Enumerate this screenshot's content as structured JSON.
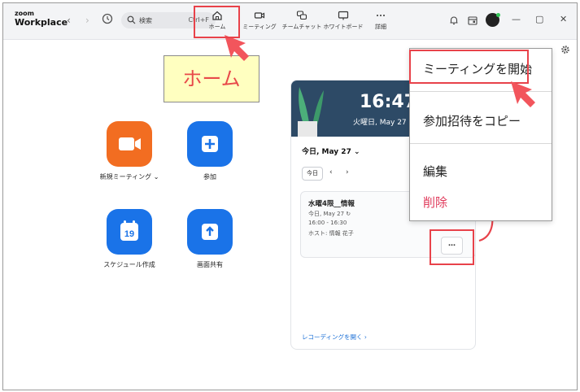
{
  "brand": {
    "line1": "zoom",
    "line2": "Workplace"
  },
  "search": {
    "placeholder": "検索",
    "shortcut": "Ctrl+F"
  },
  "nav": [
    {
      "label": "ホーム",
      "icon": "home-icon"
    },
    {
      "label": "ミーティング",
      "icon": "video-icon"
    },
    {
      "label": "チームチャット",
      "icon": "chat-icon"
    },
    {
      "label": "ホワイトボード",
      "icon": "whiteboard-icon"
    },
    {
      "label": "詳細",
      "icon": "more-icon"
    }
  ],
  "annotation": {
    "home_label": "ホーム"
  },
  "actions": [
    {
      "label": "新規ミーティング",
      "suffix": "⌄",
      "icon": "video-camera-icon",
      "color": "#f26d21"
    },
    {
      "label": "参加",
      "icon": "plus-icon",
      "color": "#1a73e8"
    },
    {
      "label": "スケジュール作成",
      "icon": "calendar-icon",
      "color": "#1a73e8",
      "day": "19"
    },
    {
      "label": "画面共有",
      "icon": "share-up-arrow-icon",
      "color": "#1a73e8"
    }
  ],
  "calendar": {
    "time": "16:47",
    "date": "火曜日, May 27",
    "today_selector": "今日, May 27",
    "today_button": "今日",
    "meeting": {
      "title": "水曜4限__情報",
      "date": "今日, May 27",
      "time": "16:00 - 16:30",
      "host": "ホスト: 情報 花子"
    },
    "more_label": "…",
    "recording_link": "レコーディングを開く ›"
  },
  "menu": {
    "start": "ミーティングを開始",
    "copy_invite": "参加招待をコピー",
    "edit": "編集",
    "delete": "削除"
  },
  "colors": {
    "highlight": "#e8424a",
    "link": "#1a6fd6",
    "danger": "#e0395a"
  }
}
